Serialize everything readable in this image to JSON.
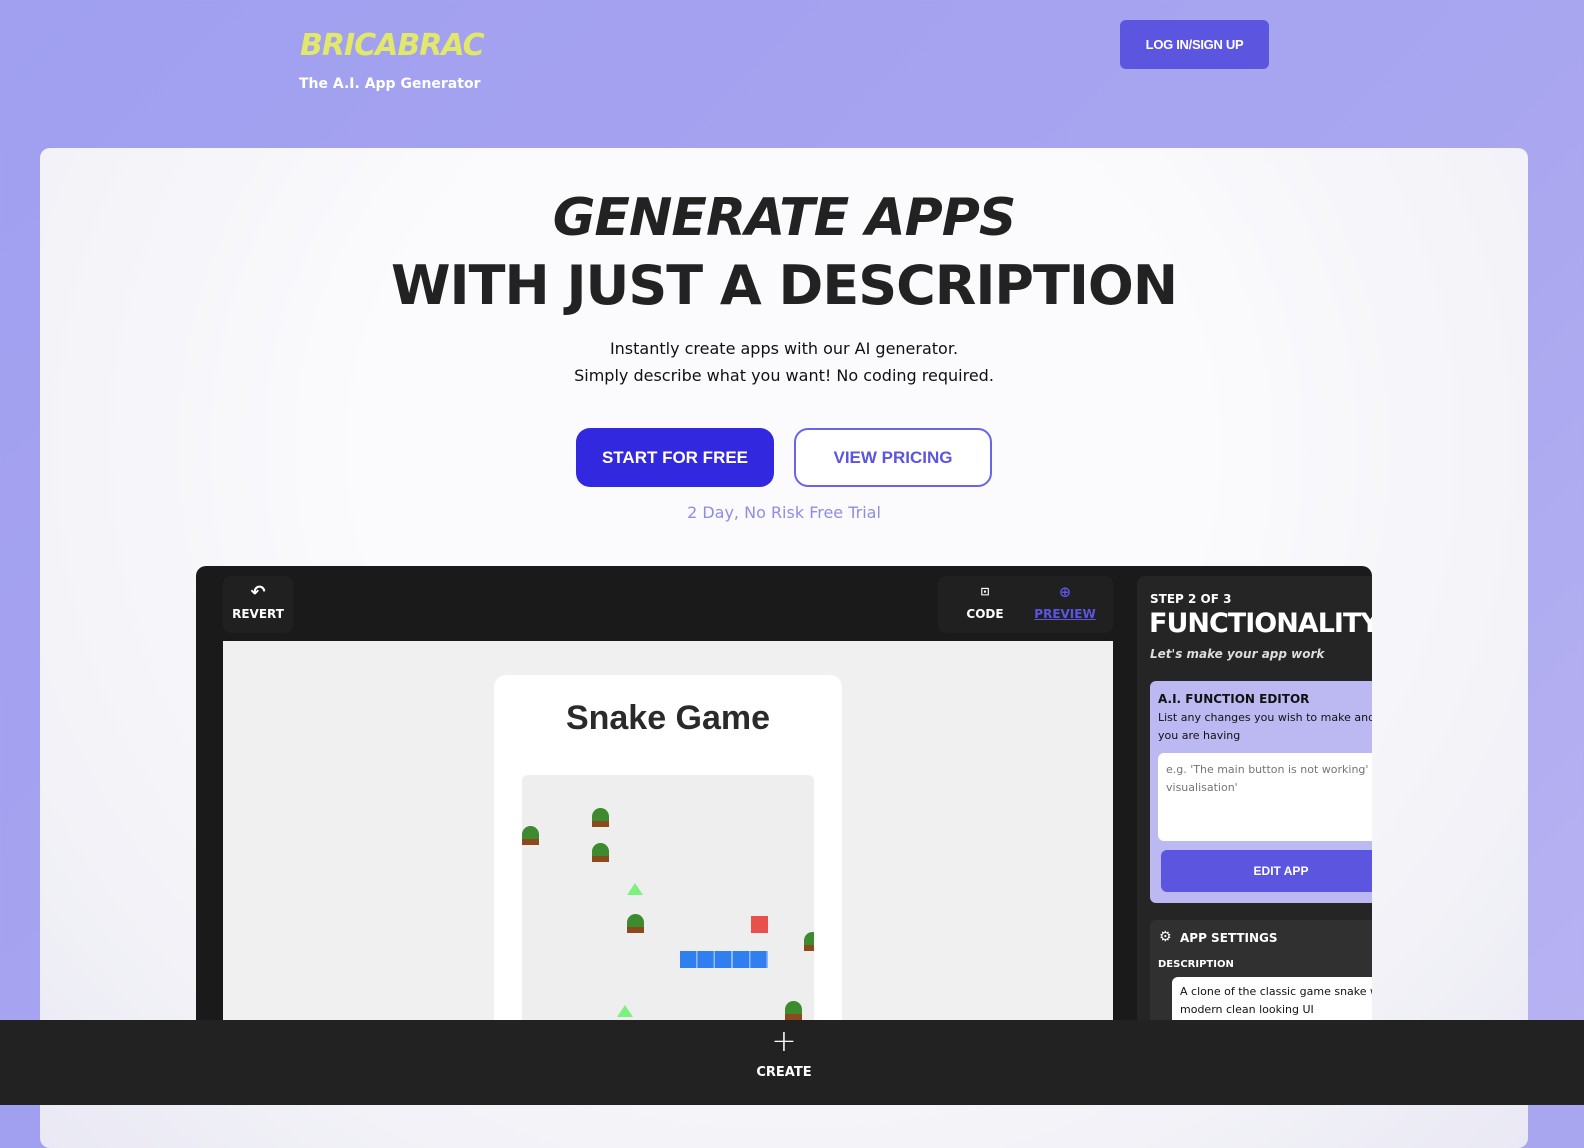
{
  "header": {
    "logo": "BRICABRAC",
    "tagline": "The A.I. App Generator",
    "login_label": "LOG IN/SIGN UP"
  },
  "hero": {
    "title_line1": "GENERATE APPS",
    "title_line2": "WITH JUST A DESCRIPTION",
    "subtitle_line1": "Instantly create apps with our AI generator.",
    "subtitle_line2": "Simply describe what you want! No coding required.",
    "start_label": "START FOR FREE",
    "pricing_label": "VIEW PRICING",
    "trial_note": "2 Day, No Risk Free Trial"
  },
  "editor": {
    "revert_label": "REVERT",
    "code_label": "CODE",
    "preview_label": "PREVIEW",
    "active_tab": "preview",
    "game_title": "Snake Game",
    "sidebar": {
      "step": "STEP 2 OF 3",
      "title": "FUNCTIONALITY",
      "subtitle": "Let's make your app work",
      "ai_editor_title": "A.I. FUNCTION EDITOR",
      "ai_editor_desc": "List any changes you wish to make and issues you are having",
      "ai_placeholder": "e.g. 'The main button is not working' or visualisation'",
      "edit_label": "EDIT APP",
      "settings_title": "APP SETTINGS",
      "description_label": "DESCRIPTION",
      "description_value": "A clone of the classic game snake with a modern clean looking UI"
    }
  },
  "bottom_bar": {
    "create_label": "CREATE"
  },
  "colors": {
    "accent": "#5b55e0",
    "primary_button": "#3228e0",
    "logo": "#e2e86a",
    "snake": "#2f7fee",
    "food": "#e8514a"
  }
}
